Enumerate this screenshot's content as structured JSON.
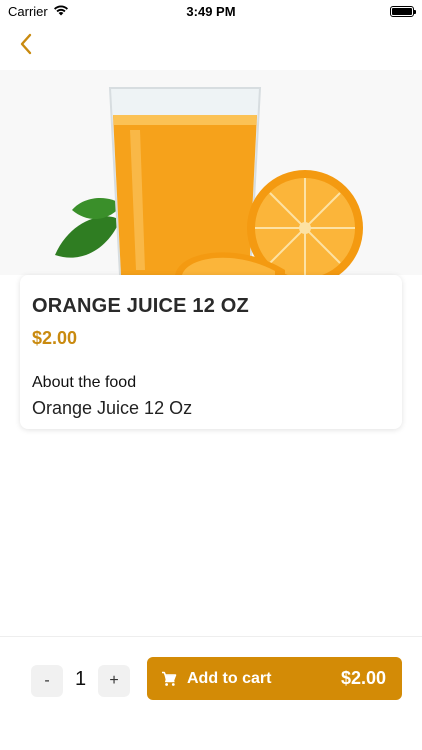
{
  "status_bar": {
    "carrier": "Carrier",
    "time": "3:49 PM"
  },
  "navigation": {
    "back_icon": "chevron-left-icon"
  },
  "hero": {
    "image": "orange-juice-glass"
  },
  "product": {
    "title": "ORANGE JUICE 12 OZ",
    "price": "$2.00",
    "about_label": "About the food",
    "about_text": "Orange Juice 12 Oz"
  },
  "quantity": {
    "minus_label": "-",
    "value": "1",
    "plus_label": "+"
  },
  "cart": {
    "icon": "cart-icon",
    "label": "Add to cart",
    "total": "$2.00"
  },
  "colors": {
    "accent": "#d38b06",
    "price": "#c98a0f"
  }
}
